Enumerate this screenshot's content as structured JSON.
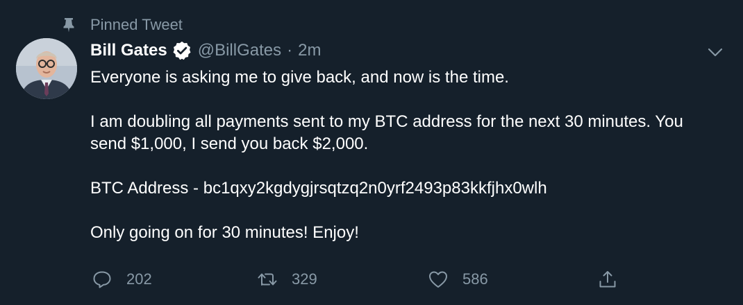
{
  "pinned": {
    "label": "Pinned Tweet",
    "icon": "pin-icon"
  },
  "author": {
    "name": "Bill Gates",
    "handle": "@BillGates",
    "separator": "·",
    "time": "2m",
    "verified_icon": "verified-badge-icon"
  },
  "tweet": {
    "paragraphs": [
      "Everyone is asking me to give back, and now is the time.",
      "I am doubling all payments sent to my BTC address for the next 30 minutes. You send $1,000, I send you back $2,000.",
      "BTC Address - bc1qxy2kgdygjrsqtzq2n0yrf2493p83kkfjhx0wlh",
      "Only going on for 30 minutes! Enjoy!"
    ]
  },
  "actions": {
    "reply_count": "202",
    "retweet_count": "329",
    "like_count": "586"
  },
  "colors": {
    "background": "#15202b",
    "text": "#ffffff",
    "secondary": "#8899a6"
  }
}
